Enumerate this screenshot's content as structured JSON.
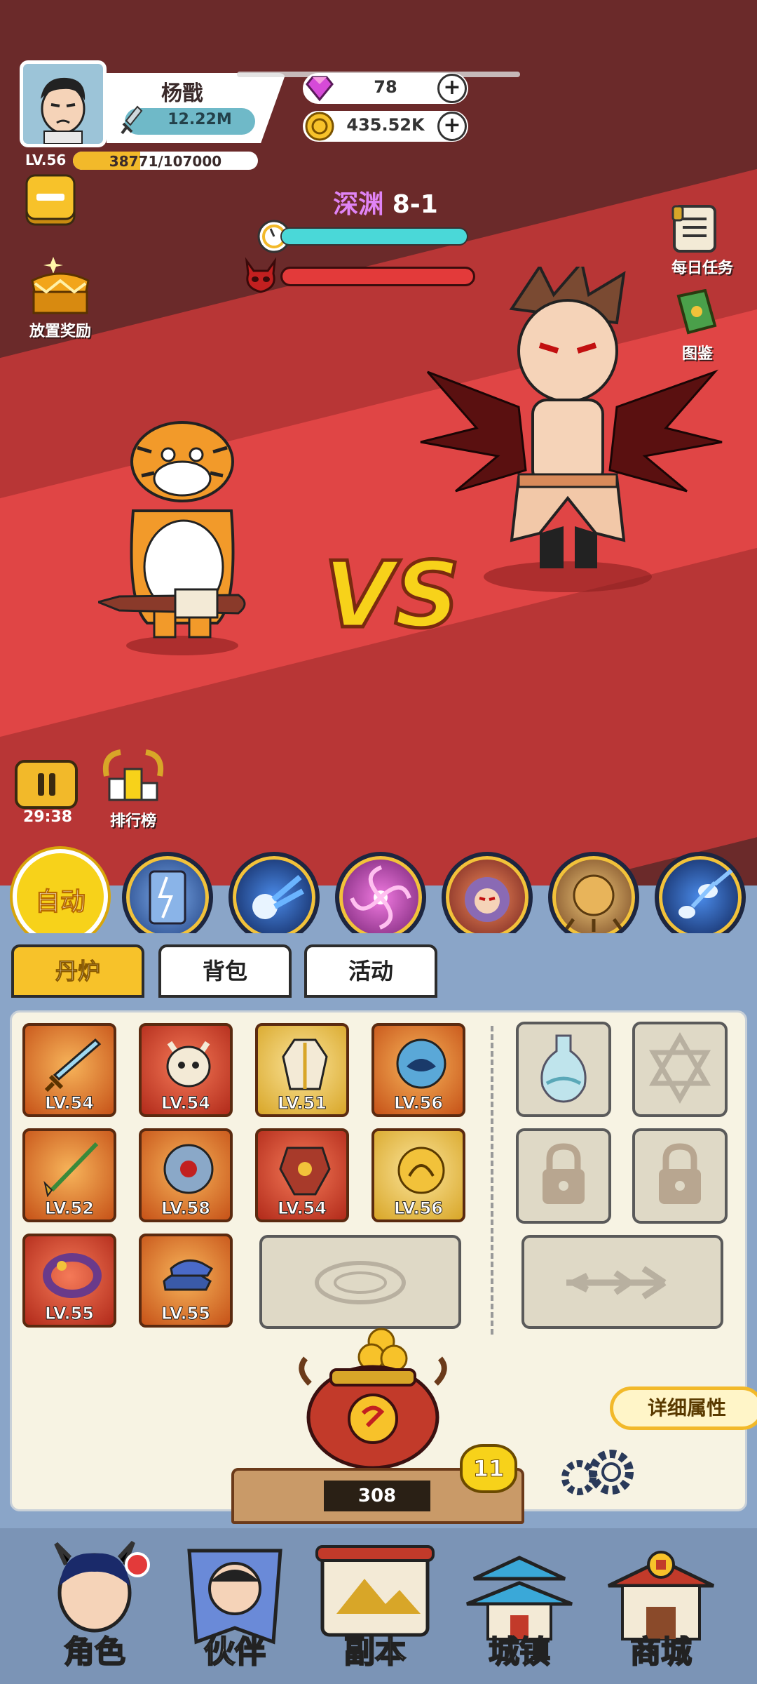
{
  "player": {
    "name": "杨戬",
    "power": "12.22M",
    "level": "LV.56",
    "xp_text": "38771/107000",
    "xp_progress": 0.362
  },
  "currency": {
    "gems": "78",
    "gold": "435.52K"
  },
  "stage": {
    "zone": "深渊",
    "number": "8-1",
    "time_progress": 1.0,
    "boss_hp_progress": 1.0
  },
  "side": {
    "idle_reward": "放置奖励",
    "daily_tasks": "每日任务",
    "codex": "图鉴",
    "ranking": "排行榜"
  },
  "battle": {
    "vs": "VS",
    "timer": "29:38"
  },
  "skills": {
    "auto_label": "自动"
  },
  "tabs": [
    "丹炉",
    "背包",
    "活动"
  ],
  "equipment": [
    {
      "level": "LV.54"
    },
    {
      "level": "LV.54"
    },
    {
      "level": "LV.51"
    },
    {
      "level": "LV.56"
    },
    {
      "level": "LV.52"
    },
    {
      "level": "LV.58"
    },
    {
      "level": "LV.54"
    },
    {
      "level": "LV.56"
    },
    {
      "level": "LV.55"
    },
    {
      "level": "LV.55"
    }
  ],
  "furnace": {
    "count": "308",
    "level": "11",
    "detail_label": "详细属性"
  },
  "nav": [
    "角色",
    "伙伴",
    "副本",
    "城镇",
    "商城"
  ]
}
